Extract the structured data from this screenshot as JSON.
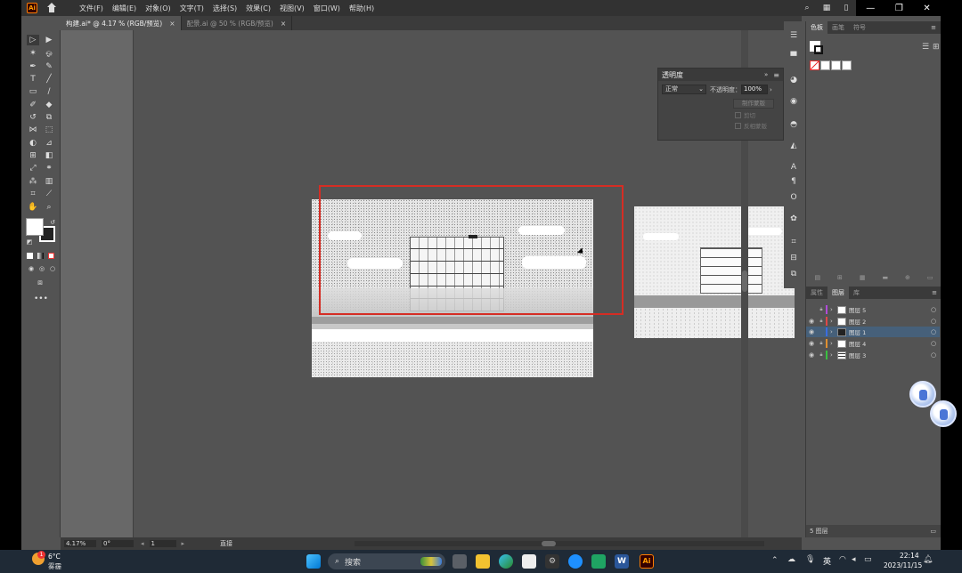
{
  "menubar": {
    "logo": "Ai",
    "items": [
      "文件(F)",
      "编辑(E)",
      "对象(O)",
      "文字(T)",
      "选择(S)",
      "效果(C)",
      "视图(V)",
      "窗口(W)",
      "帮助(H)"
    ]
  },
  "tabs": [
    {
      "label": "构建.ai* @ 4.17 % (RGB/预览)",
      "close": "×",
      "active": true
    },
    {
      "label": "配景.ai @ 50 % (RGB/预览)",
      "close": "×",
      "active": false
    }
  ],
  "transparency_panel": {
    "title": "透明度",
    "blend_mode": "正常",
    "opacity_label": "不透明度：",
    "opacity_value": "100%",
    "make_mask_label": "制作蒙版",
    "clip_label": "剪切",
    "invert_label": "反相蒙版"
  },
  "right_panels": {
    "top_tabs": [
      "色板",
      "画笔",
      "符号"
    ],
    "layers_tabs": [
      "属性",
      "图层",
      "库"
    ],
    "layers": [
      {
        "name": "图层 5",
        "color": "#b04bd8",
        "visible": false,
        "selected": false
      },
      {
        "name": "图层 2",
        "color": "#e04848",
        "visible": true,
        "selected": false
      },
      {
        "name": "图层 1",
        "color": "#3a6de0",
        "visible": true,
        "selected": true
      },
      {
        "name": "图层 4",
        "color": "#e09030",
        "visible": true,
        "selected": false
      },
      {
        "name": "图层 3",
        "color": "#3ac040",
        "visible": true,
        "selected": false
      }
    ],
    "layer_count": "5 图层"
  },
  "status_bar": {
    "zoom": "4.17%",
    "rotation": "0°",
    "artboard_num": "1",
    "tool": "直接"
  },
  "taskbar": {
    "weather_temp": "6°C",
    "weather_text": "雾霾",
    "weather_badge": "1",
    "search_label": "搜索",
    "ime": "英",
    "time": "22:14",
    "date": "2023/11/15"
  },
  "colors": {
    "highlight_rect": "#d52d24",
    "selected_layer": "#46607a",
    "app_bg": "#535353",
    "pasteboard": "#686868"
  }
}
